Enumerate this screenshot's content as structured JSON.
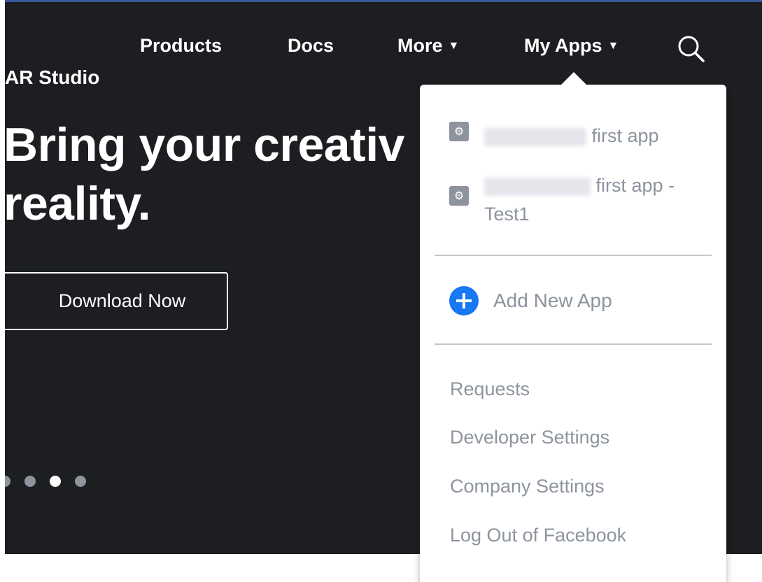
{
  "nav": {
    "products": "Products",
    "docs": "Docs",
    "more": "More",
    "my_apps": "My Apps",
    "caret": "▼"
  },
  "brand": "AR Studio",
  "hero": {
    "headline_line1": "Bring your creativ",
    "headline_line2": "reality.",
    "download_label": "Download Now"
  },
  "carousel": {
    "dot_count": 4,
    "active_index": 2
  },
  "dropdown": {
    "apps": [
      {
        "name_suffix": " first app",
        "icon": "gear-icon"
      },
      {
        "name_suffix": " first app -",
        "name_line2": "Test1",
        "icon": "gear-icon"
      }
    ],
    "add_new_app": "Add New App",
    "links": [
      "Requests",
      "Developer Settings",
      "Company Settings",
      "Log Out of Facebook"
    ]
  },
  "colors": {
    "hero_bg": "#1c1e21",
    "accent_blue": "#1877f2",
    "menu_text": "#8d949e",
    "top_line": "#3b5998"
  }
}
